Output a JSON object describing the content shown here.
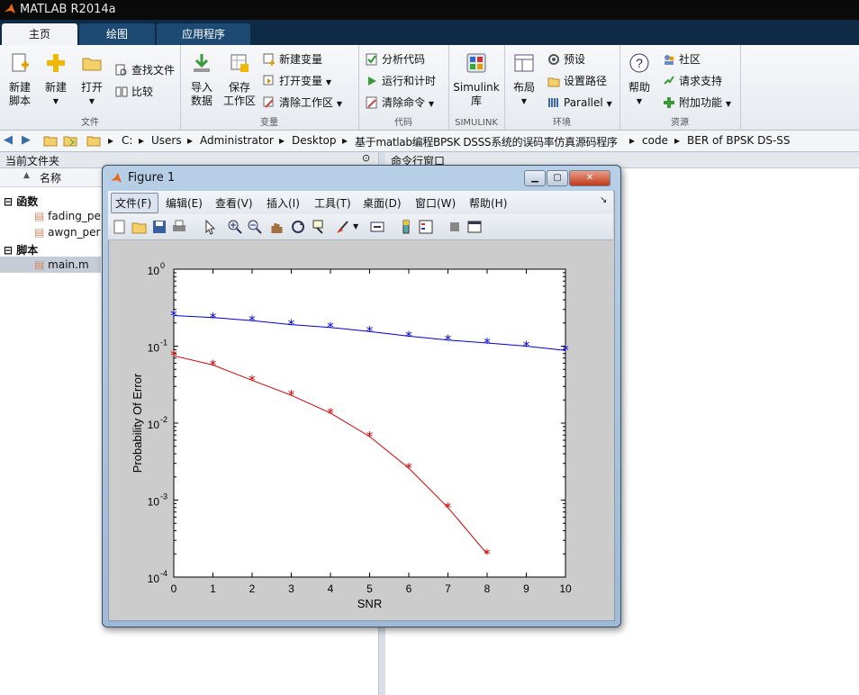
{
  "app": {
    "title": "MATLAB R2014a"
  },
  "ribbon": {
    "tabs": [
      "主页",
      "绘图",
      "应用程序"
    ],
    "groups": {
      "file": {
        "label": "文件",
        "new_script": "新建\n脚本",
        "new": "新建",
        "open": "打开",
        "find_files": "查找文件",
        "compare": "比较"
      },
      "variable": {
        "label": "变量",
        "import": "导入\n数据",
        "save_ws": "保存\n工作区",
        "new_var": "新建变量",
        "open_var": "打开变量",
        "clear_ws": "清除工作区"
      },
      "code": {
        "label": "代码",
        "analyze": "分析代码",
        "run_time": "运行和计时",
        "clear_cmd": "清除命令"
      },
      "simulink": {
        "label": "SIMULINK",
        "simulink": "Simulink\n库"
      },
      "env": {
        "label": "环境",
        "layout": "布局",
        "prefs": "预设",
        "set_path": "设置路径",
        "parallel": "Parallel"
      },
      "resources": {
        "label": "资源",
        "help": "帮助",
        "community": "社区",
        "support": "请求支持",
        "addons": "附加功能"
      }
    }
  },
  "address": {
    "crumbs": [
      "C:",
      "Users",
      "Administrator",
      "Desktop",
      "基于matlab编程BPSK DSSS系统的误码率仿真源码程序",
      "code",
      "BER of BPSK DS-SS"
    ]
  },
  "current_folder": {
    "header": "当前文件夹",
    "col_name": "名称",
    "col_name_sort": "▲",
    "sections": [
      {
        "label": "函数",
        "files": [
          "fading_pe",
          "awgn_per"
        ]
      },
      {
        "label": "脚本",
        "files": [
          "main.m"
        ]
      }
    ]
  },
  "command_window": {
    "header": "命令行窗口"
  },
  "figure": {
    "title": "Figure 1",
    "menu": [
      "文件(F)",
      "编辑(E)",
      "查看(V)",
      "插入(I)",
      "工具(T)",
      "桌面(D)",
      "窗口(W)",
      "帮助(H)"
    ],
    "toolbar_icons": [
      "new-figure-icon",
      "open-icon",
      "save-icon",
      "print-icon",
      "pointer-icon",
      "zoom-in-icon",
      "zoom-out-icon",
      "pan-icon",
      "rotate-icon",
      "data-cursor-icon",
      "brush-icon",
      "link-icon",
      "colorbar-icon",
      "legend-icon",
      "hide-tools-icon",
      "show-tools-icon"
    ]
  },
  "chart_data": {
    "type": "line",
    "xlabel": "SNR",
    "ylabel": "Probability Of Error",
    "xlim": [
      0,
      10
    ],
    "ylim": [
      0.0001,
      1
    ],
    "yscale": "log",
    "x_ticks": [
      "0",
      "1",
      "2",
      "3",
      "4",
      "5",
      "6",
      "7",
      "8",
      "9",
      "10"
    ],
    "y_ticks": [
      {
        "base": "10",
        "exp": "0"
      },
      {
        "base": "10",
        "exp": "-1"
      },
      {
        "base": "10",
        "exp": "-2"
      },
      {
        "base": "10",
        "exp": "-3"
      },
      {
        "base": "10",
        "exp": "-4"
      }
    ],
    "grid": false,
    "series": [
      {
        "color": "#0000cc",
        "marker": "*",
        "x": [
          0,
          1,
          2,
          3,
          4,
          5,
          6,
          7,
          8,
          9,
          10
        ],
        "y": [
          0.25,
          0.235,
          0.215,
          0.19,
          0.175,
          0.155,
          0.135,
          0.12,
          0.11,
          0.1,
          0.088
        ]
      },
      {
        "color": "#cc0000",
        "marker": "*",
        "x": [
          0,
          1,
          2,
          3,
          4,
          5,
          6,
          7,
          8
        ],
        "y": [
          0.075,
          0.057,
          0.036,
          0.023,
          0.0135,
          0.0067,
          0.0026,
          0.0008,
          0.0002
        ]
      }
    ]
  }
}
